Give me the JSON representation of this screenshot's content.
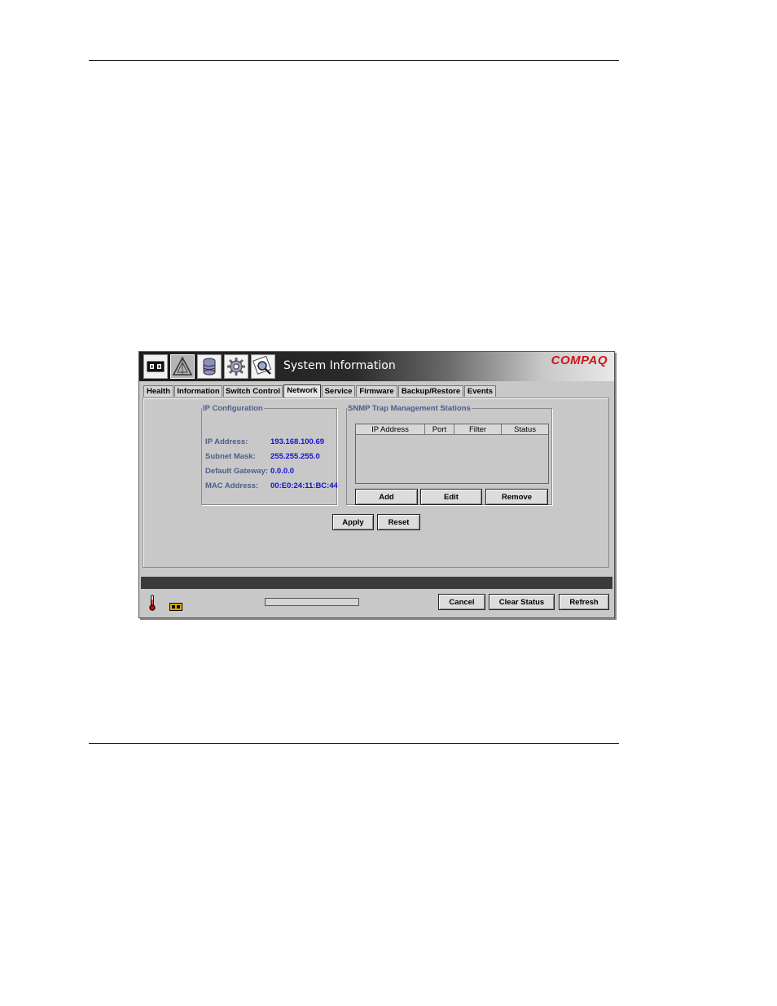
{
  "header": {
    "title": "System Information",
    "brand": "COMPAQ",
    "icons": [
      "switch-icon",
      "fabric-icon",
      "storage-icon",
      "settings-gear-icon",
      "search-icon"
    ]
  },
  "tabs": [
    {
      "label": "Health",
      "active": false
    },
    {
      "label": "Information",
      "active": false
    },
    {
      "label": "Switch Control",
      "active": false
    },
    {
      "label": "Network",
      "active": true
    },
    {
      "label": "Service",
      "active": false
    },
    {
      "label": "Firmware",
      "active": false
    },
    {
      "label": "Backup/Restore",
      "active": false
    },
    {
      "label": "Events",
      "active": false
    }
  ],
  "ip_config": {
    "legend": "IP Configuration",
    "fields": [
      {
        "label": "IP Address:",
        "value": "193.168.100.69"
      },
      {
        "label": "Subnet Mask:",
        "value": "255.255.255.0"
      },
      {
        "label": "Default Gateway:",
        "value": "0.0.0.0"
      },
      {
        "label": "MAC Address:",
        "value": "00:E0:24:11:BC:44"
      }
    ]
  },
  "snmp": {
    "legend": "SNMP Trap Management Stations",
    "columns": [
      "IP Address",
      "Port",
      "Filter",
      "Status"
    ],
    "rows": [],
    "add_label": "Add",
    "edit_label": "Edit",
    "remove_label": "Remove"
  },
  "form": {
    "apply_label": "Apply",
    "reset_label": "Reset"
  },
  "footer": {
    "icons": [
      "thermometer-icon",
      "switch-status-icon"
    ],
    "progress": 0,
    "cancel_label": "Cancel",
    "clear_status_label": "Clear Status",
    "refresh_label": "Refresh"
  },
  "colors": {
    "brand": "#d0161b",
    "label": "#4b5e8a",
    "value": "#1515d0",
    "window_bg": "#c8c8c8",
    "status_bar": "#3a3a3a"
  }
}
